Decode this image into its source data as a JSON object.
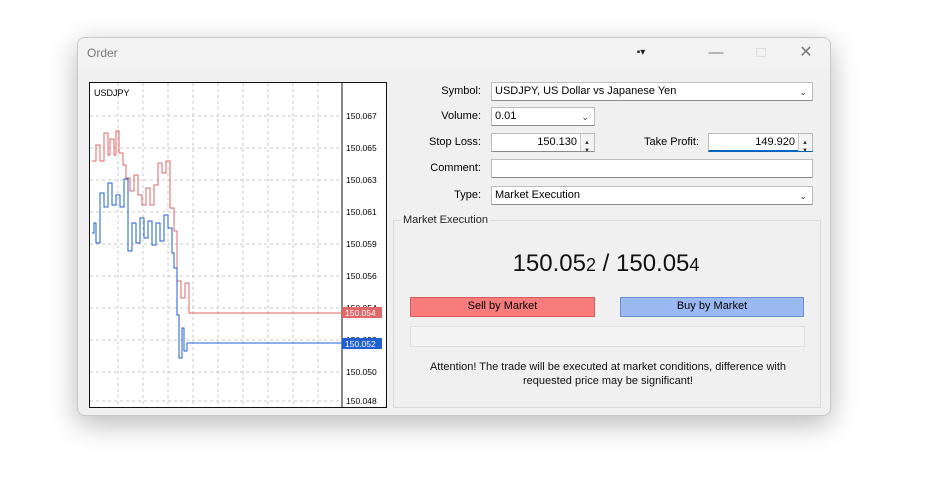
{
  "window": {
    "title": "Order",
    "pin_icon": "pin-icon",
    "minimize_icon": "minimize-icon",
    "maximize_icon": "maximize-icon",
    "close_icon": "close-icon"
  },
  "chart": {
    "symbol": "USDJPY",
    "price_labels": [
      "150.067",
      "150.065",
      "150.063",
      "150.061",
      "150.059",
      "150.056",
      "150.054",
      "150.052",
      "150.050",
      "150.048"
    ],
    "ask_badge": "150.054",
    "bid_badge": "150.052",
    "ask_color": "#e06767",
    "bid_color": "#1f5fd0"
  },
  "form": {
    "symbol_label": "Symbol:",
    "symbol_value": "USDJPY, US Dollar vs Japanese Yen",
    "volume_label": "Volume:",
    "volume_value": "0.01",
    "stoploss_label": "Stop Loss:",
    "stoploss_value": "150.130",
    "takeprofit_label": "Take Profit:",
    "takeprofit_value": "149.920",
    "comment_label": "Comment:",
    "comment_value": "",
    "type_label": "Type:",
    "type_value": "Market Execution"
  },
  "execution": {
    "group_title": "Market Execution",
    "bid_main": "150.05",
    "bid_last": "2",
    "separator": " / ",
    "ask_main": "150.05",
    "ask_last": "4",
    "sell_label": "Sell by Market",
    "buy_label": "Buy by Market",
    "sell_color": "#f97c7c",
    "buy_color": "#9ab9f2",
    "attention_line1": "Attention! The trade will be executed at market conditions, difference with",
    "attention_line2": "requested price may be significant!"
  }
}
